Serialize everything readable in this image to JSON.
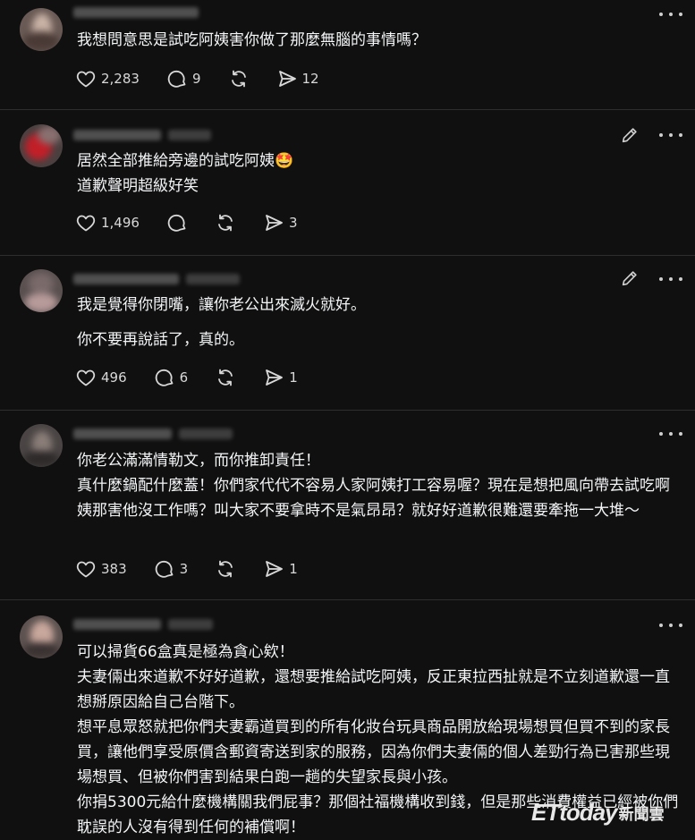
{
  "posts": [
    {
      "text": "我想問意思是試吃阿姨害你做了那麼無腦的事情嗎？",
      "likes": "2,283",
      "comments": "9",
      "reposts": "",
      "shares": "12"
    },
    {
      "text": "居然全部推給旁邊的試吃阿姨🤩\n道歉聲明超級好笑",
      "likes": "1,496",
      "comments": "",
      "reposts": "",
      "shares": "3"
    },
    {
      "text_p1": "我是覺得你閉嘴，讓你老公出來滅火就好。",
      "text_p2": "你不要再說話了，真的。",
      "likes": "496",
      "comments": "6",
      "reposts": "",
      "shares": "1"
    },
    {
      "text": "你老公滿滿情勒文，而你推卸責任！\n真什麼鍋配什麼蓋！你們家代代不容易人家阿姨打工容易喔？現在是想把風向帶去試吃啊姨那害他沒工作嗎？叫大家不要拿時不是氣昂昂？就好好道歉很難還要牽拖一大堆～",
      "likes": "383",
      "comments": "3",
      "reposts": "",
      "shares": "1"
    },
    {
      "text": "可以掃貨66盒真是極為貪心欸！\n夫妻倆出來道歉不好好道歉，還想要推給試吃阿姨，反正東拉西扯就是不立刻道歉還一直想掰原因給自己台階下。\n想平息眾怒就把你們夫妻霸道買到的所有化妝台玩具商品開放給現場想買但買不到的家長買，讓他們享受原價含郵資寄送到家的服務，因為你們夫妻倆的個人差勁行為已害那些現場想買、但被你們害到結果白跑一趟的失望家長與小孩。\n你捐5300元給什麼機構關我們屁事？那個社福機構收到錢，但是那些消費權益已經被你們耽誤的人沒有得到任何的補償啊！"
    }
  ],
  "icons": {
    "like": "heart-icon",
    "comment": "comment-bubble-icon",
    "repost": "repost-icon",
    "share": "send-icon",
    "more": "more-dots-icon",
    "edit": "pencil-edit-icon"
  },
  "watermark": {
    "brand": "ETtoday",
    "suffix": "新聞雲"
  }
}
